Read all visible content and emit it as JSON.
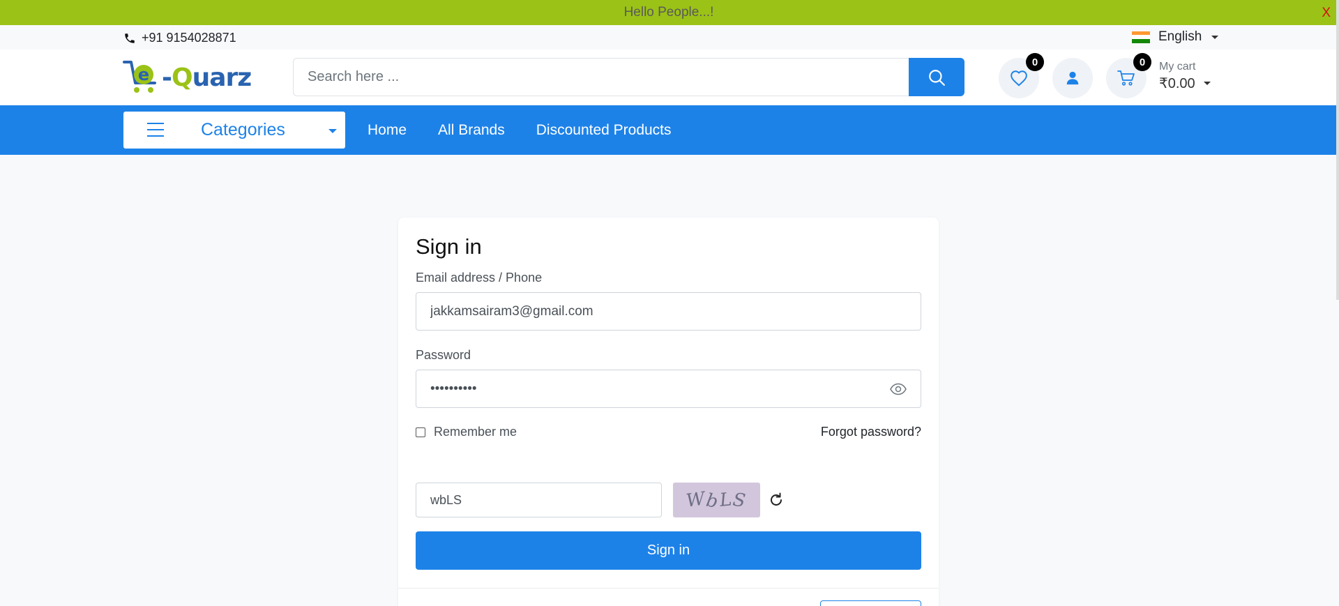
{
  "announcement": {
    "message": "Hello People...!",
    "close_label": "X"
  },
  "topbar": {
    "phone": "+91 9154028871",
    "language": "English",
    "flag_colors": [
      "#ff9933",
      "#ffffff",
      "#138808"
    ]
  },
  "header": {
    "logo_prefix": "e",
    "logo_dash": "-",
    "logo_q": "Q",
    "logo_rest": "uarz",
    "search_placeholder": "Search here ...",
    "wishlist_count": "0",
    "cart_count": "0",
    "cart_label": "My cart",
    "cart_total": "₹0.00"
  },
  "nav": {
    "categories_label": "Categories",
    "links": [
      "Home",
      "All Brands",
      "Discounted Products"
    ]
  },
  "signin": {
    "title": "Sign in",
    "email_label": "Email address / Phone",
    "email_value": "jakkamsairam3@gmail.com",
    "password_label": "Password",
    "password_value": "••••••••••",
    "remember_label": "Remember me",
    "forgot_label": "Forgot password?",
    "captcha_value": "wbLS",
    "captcha_chars": [
      "W",
      "b",
      "L",
      "S"
    ],
    "submit_label": "Sign in"
  },
  "colors": {
    "announcement_bg": "#9bc216",
    "primary": "#1d82e8",
    "close": "#d40f0f"
  }
}
